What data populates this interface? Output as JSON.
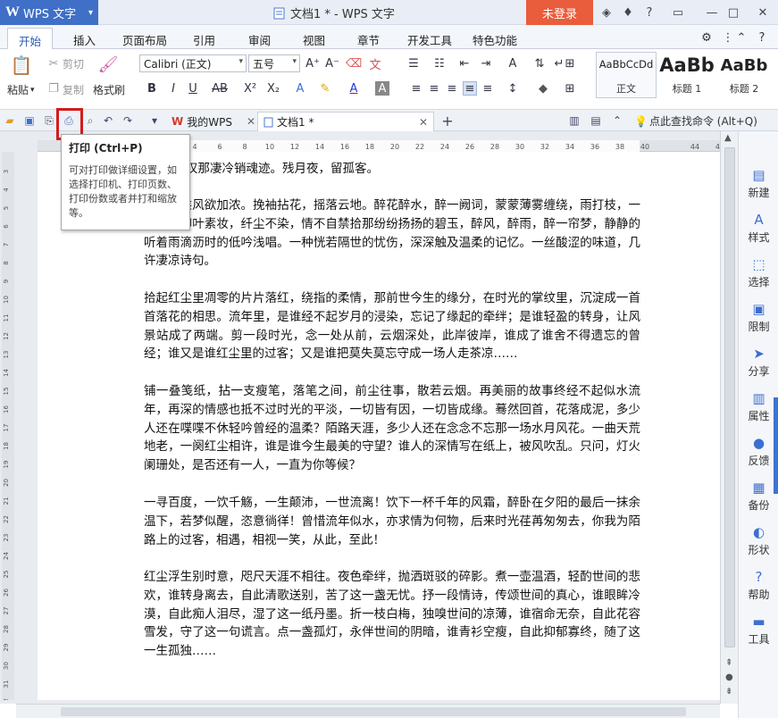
{
  "app": {
    "logo": "W",
    "name": "WPS 文字",
    "dropdown": "▾"
  },
  "window": {
    "title": "文档1 * - WPS 文字",
    "login": "未登录"
  },
  "titlebar_icons": [
    "shirt-icon",
    "question-icon",
    "minimize-window-icon",
    "restore-icon",
    "close-icon"
  ],
  "menus": [
    "开始",
    "插入",
    "页面布局",
    "引用",
    "审阅",
    "视图",
    "章节",
    "开发工具",
    "特色功能"
  ],
  "ribbon": {
    "paste": "粘贴",
    "cut": "剪切",
    "copy": "复制",
    "format_painter": "格式刷",
    "font": "Calibri (正文)",
    "size": "五号",
    "styles": [
      {
        "sample": "AaBbCcDd",
        "name": "正文"
      },
      {
        "sample": "AaBb",
        "name": "标题 1"
      },
      {
        "sample": "AaBb",
        "name": "标题 2"
      }
    ]
  },
  "tabs": {
    "mywps": "我的WPS",
    "doc": "文档1 *",
    "add": "+",
    "search": "点此查找命令 (Alt+Q)"
  },
  "tooltip": {
    "title": "打印 (Ctrl+P)",
    "body": "可对打印做详细设置，如选择打印机、打印页数、打印份数或者并打和缩放等。"
  },
  "document": {
    "paragraphs": [
      "叹那凄冷销魂迹。残月夜，留孤客。",
      "轻愁，乘风欲加浓。挽袖拈花，摇落云地。醉花醉水，醉一阙词，蒙蒙薄雾缠绕，雨打枝，一直喜欢柳叶素妆，纤尘不染，情不自禁拾那纷纷扬扬的碧玉，醉风，醉雨，醉一帘梦，静静的听着雨滴沥时的低吟浅唱。一种恍若隔世的忧伤，深深触及温柔的记忆。一丝酸涩的味道，几许凄凉诗句。",
      "拾起红尘里凋零的片片落红，绕指的柔情，那前世今生的缘分，在时光的掌纹里，沉淀成一首首落花的相思。流年里，是谁经不起岁月的浸染，忘记了缘起的牵绊；是谁轻盈的转身，让风景站成了两端。剪一段时光，念一处从前，云烟深处，此岸彼岸，谁成了谁舍不得遗忘的曾经；谁又是谁红尘里的过客；又是谁把莫失莫忘守成一场人走茶凉……",
      "铺一叠笺纸，拈一支瘦笔，落笔之间，前尘往事，散若云烟。再美丽的故事终经不起似水流年，再深的情感也抵不过时光的平淡，一切皆有因，一切皆成缘。蓦然回首，花落成泥，多少人还在喋喋不休轻吟曾经的温柔？陌路天涯，多少人还在念念不忘那一场水月风花。一曲天荒地老，一阕红尘相许，谁是谁今生最美的守望？谁人的深情写在纸上，被风吹乱。只问，灯火阑珊处，是否还有一人，一直为你等候？",
      "一寻百度，一饮千觞，一生颠沛，一世流离！饮下一杯千年的风霜，醉卧在夕阳的最后一抹余温下，若梦似醒，恣意徜徉！曾惜流年似水，亦求情为何物，后来时光荏苒匆匆去，你我为陌路上的过客，相遇，相视一笑，从此，至此！",
      "红尘浮生别时意，咫尺天涯不相往。夜色牵绊，抛洒斑驳的碎影。煮一壶温酒，轻酌世间的悲欢，谁转身离去，自此清歌送别，苦了这一盏无忧。抒一段情诗，传颂世间的真心，谁眼眸冷漠，自此痴人泪尽，湿了这一纸丹墨。折一枝白梅，独嗅世间的凉薄，谁宿命无奈，自此花容雪发，守了这一句谎言。点一盏孤灯，永伴世间的阴暗，谁青衫空瘦，自此抑郁寡终，随了这一生孤独……"
    ]
  },
  "ruler": {
    "h_ticks": [
      "2",
      "",
      "2",
      "4",
      "6",
      "8",
      "10",
      "12",
      "14",
      "16",
      "18",
      "20",
      "22",
      "24",
      "26",
      "28",
      "30",
      "32",
      "34",
      "36",
      "38",
      "40",
      "",
      "44",
      "46"
    ],
    "v_ticks": [
      "3",
      "4",
      "5",
      "6",
      "7",
      "8",
      "9",
      "10",
      "11",
      "12",
      "13",
      "14",
      "15",
      "16",
      "17",
      "18",
      "19",
      "20",
      "21",
      "22",
      "23",
      "24",
      "25",
      "26",
      "27",
      "28",
      "29",
      "30",
      "31",
      "32"
    ]
  },
  "right_panel": [
    {
      "icon": "new-icon",
      "glyph": "▤",
      "label": "新建"
    },
    {
      "icon": "style-icon",
      "glyph": "A",
      "label": "样式"
    },
    {
      "icon": "select-icon",
      "glyph": "⬚",
      "label": "选择"
    },
    {
      "icon": "restrict-icon",
      "glyph": "▣",
      "label": "限制"
    },
    {
      "icon": "share-icon",
      "glyph": "➤",
      "label": "分享"
    },
    {
      "icon": "properties-icon",
      "glyph": "▥",
      "label": "属性"
    },
    {
      "icon": "feedback-icon",
      "glyph": "●",
      "label": "反馈"
    },
    {
      "icon": "backup-icon",
      "glyph": "▦",
      "label": "备份"
    },
    {
      "icon": "shape-icon",
      "glyph": "◐",
      "label": "形状"
    },
    {
      "icon": "help-icon",
      "glyph": "?",
      "label": "帮助"
    },
    {
      "icon": "tools-icon",
      "glyph": "▬",
      "label": "工具"
    }
  ],
  "colors": {
    "titlebar": "#e9eef6",
    "app": "#3f6fc6",
    "login": "#e95c3c",
    "highlight": "#d21c1c",
    "accent": "#3b6fd0"
  }
}
